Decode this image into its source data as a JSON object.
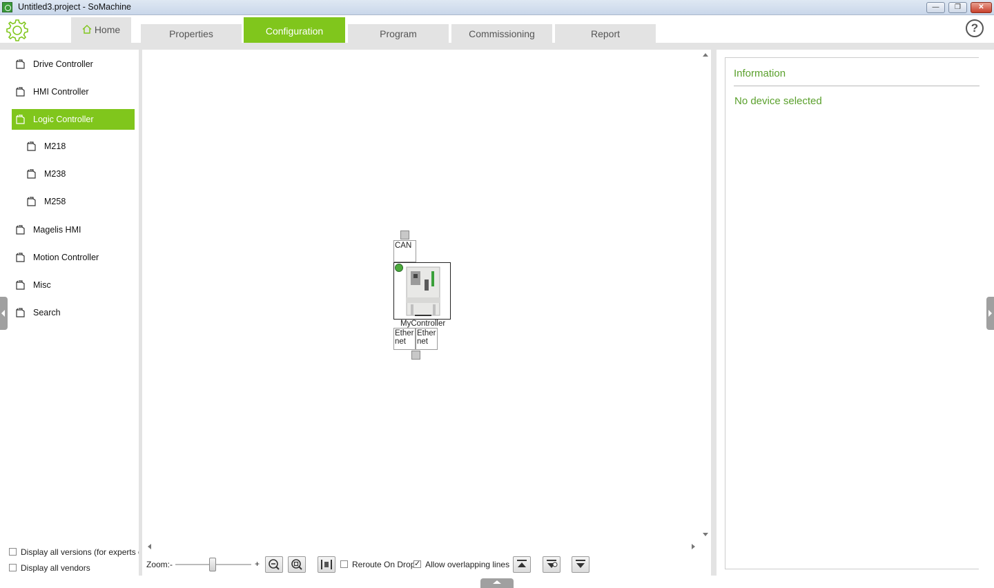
{
  "window": {
    "title": "Untitled3.project - SoMachine",
    "minimize": "—",
    "restore": "❐",
    "close": "✕"
  },
  "tabs": [
    {
      "label": "Home"
    },
    {
      "label": "Properties"
    },
    {
      "label": "Configuration"
    },
    {
      "label": "Program"
    },
    {
      "label": "Commissioning"
    },
    {
      "label": "Report"
    }
  ],
  "help": "?",
  "catalog": {
    "items": [
      {
        "label": "Drive Controller"
      },
      {
        "label": "HMI Controller"
      },
      {
        "label": "Logic Controller"
      },
      {
        "label": "M218"
      },
      {
        "label": "M238"
      },
      {
        "label": "M258"
      },
      {
        "label": "Magelis HMI"
      },
      {
        "label": "Motion Controller"
      },
      {
        "label": "Misc"
      },
      {
        "label": "Search"
      }
    ],
    "selected": "Logic Controller",
    "options": [
      {
        "label": "Display all versions (for experts on",
        "checked": false
      },
      {
        "label": "Display all vendors",
        "checked": false
      }
    ]
  },
  "canvas": {
    "device_name": "MyController",
    "port_top": "CAN",
    "port_bottom_1_line1": "Ether",
    "port_bottom_1_line2": "net",
    "port_bottom_2_line1": "Ether",
    "port_bottom_2_line2": "net"
  },
  "toolbar": {
    "zoom_label": "Zoom:-",
    "zoom_plus": "+",
    "zoom_level": 0.48,
    "reroute_label": "Reroute On Drop",
    "reroute_checked": false,
    "overlap_label": "Allow overlapping lines",
    "overlap_checked": true
  },
  "info": {
    "title": "Information",
    "message": "No device selected"
  },
  "colors": {
    "accent": "#80c61c",
    "info_text": "#5aa02c",
    "tab_bg": "#e3e3e3"
  }
}
